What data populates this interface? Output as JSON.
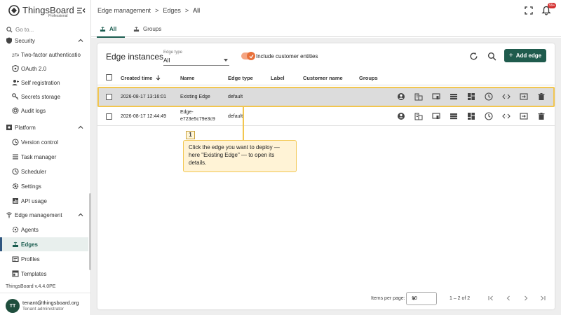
{
  "app": {
    "logo_text": "ThingsBoard",
    "logo_sub": "Professional",
    "version": "ThingsBoard v.4.4.0PE"
  },
  "search": {
    "placeholder": "Go to..."
  },
  "sidebar": {
    "items": [
      {
        "label": "Security",
        "type": "section",
        "icon": "security-icon"
      },
      {
        "label": "Two-factor authenticatio",
        "icon": "two-factor-icon"
      },
      {
        "label": "OAuth 2.0",
        "icon": "oauth-icon"
      },
      {
        "label": "Self registration",
        "icon": "person-add-icon"
      },
      {
        "label": "Secrets storage",
        "icon": "key-icon"
      },
      {
        "label": "Audit logs",
        "icon": "track-changes-icon"
      },
      {
        "label": "Platform",
        "type": "section",
        "icon": "settings-applications-icon"
      },
      {
        "label": "Version control",
        "icon": "history-icon"
      },
      {
        "label": "Task manager",
        "icon": "task-icon"
      },
      {
        "label": "Scheduler",
        "icon": "schedule-icon"
      },
      {
        "label": "Settings",
        "icon": "gear-icon"
      },
      {
        "label": "API usage",
        "icon": "insert-chart-icon"
      },
      {
        "label": "Edge management",
        "type": "section",
        "icon": "router-icon"
      },
      {
        "label": "Agents",
        "icon": "agents-icon"
      },
      {
        "label": "Edges",
        "icon": "edge-icon",
        "active": true
      },
      {
        "label": "Profiles",
        "icon": "profiles-icon"
      },
      {
        "label": "Templates",
        "icon": "templates-icon"
      }
    ]
  },
  "user": {
    "initials": "TT",
    "email": "tenant@thingsboard.org",
    "role": "Tenant administrator"
  },
  "header": {
    "breadcrumb": [
      "Edge management",
      "Edges",
      "All"
    ],
    "separator": ">",
    "notification_badge": "99+"
  },
  "tabs": [
    {
      "label": "All",
      "active": true
    },
    {
      "label": "Groups"
    }
  ],
  "card": {
    "title": "Edge instances",
    "edge_type_label": "Edge type",
    "edge_type_value": "All",
    "include_customer_label": "Include customer entities",
    "add_button": "Add edge"
  },
  "table": {
    "columns": [
      "Created time",
      "Name",
      "Edge type",
      "Label",
      "Customer name",
      "Groups"
    ],
    "rows": [
      {
        "created": "2026-08-17 13:16:01",
        "name": "Existing Edge",
        "edge_type": "default",
        "label": "",
        "customer": "",
        "groups": ""
      },
      {
        "created": "2026-08-17 12:44:49",
        "name": "Edge-",
        "name2": "e723e5c79e3c9",
        "edge_type": "default",
        "label": "",
        "customer": "",
        "groups": ""
      }
    ],
    "row_actions": [
      "account-circle-icon",
      "business-icon",
      "devices-icon",
      "view-list-icon",
      "dashboard-icon",
      "schedule-icon",
      "code-icon",
      "input-icon",
      "delete-icon"
    ]
  },
  "callout": {
    "number": "1",
    "text": "Click the edge you want to deploy — here \"Existing Edge\" — to open its details."
  },
  "pagination": {
    "items_per_page_label": "Items per page:",
    "items_per_page_value": "10",
    "range": "1 – 2 of 2"
  },
  "colors": {
    "primary": "#1f5b4d",
    "accent": "#e8703a",
    "highlight": "#f2c64f"
  }
}
